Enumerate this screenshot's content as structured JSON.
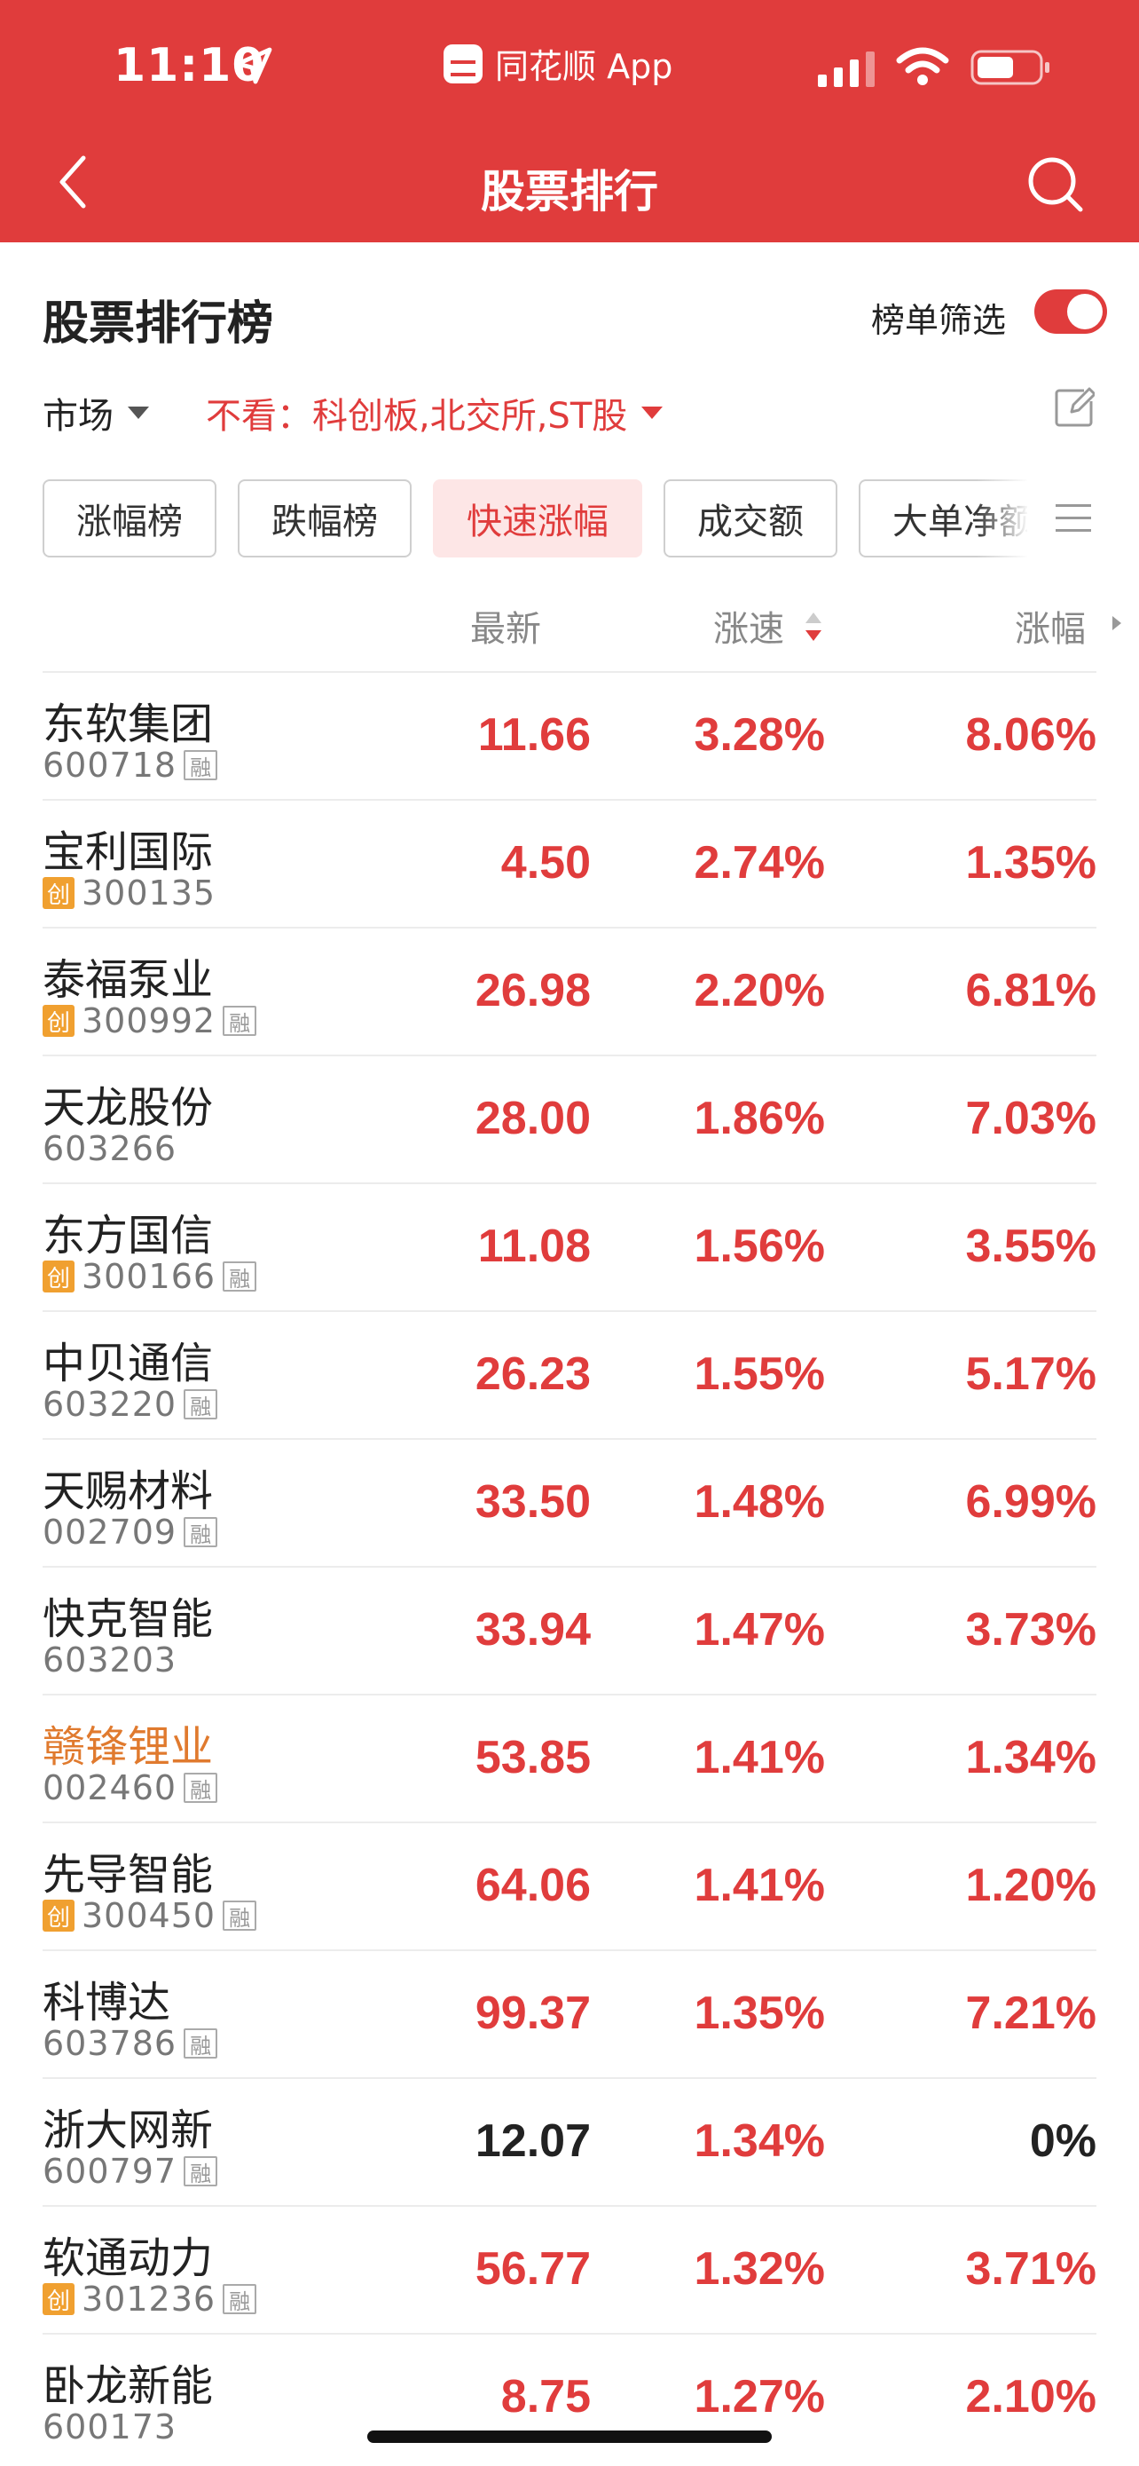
{
  "status_bar": {
    "time": "11:10",
    "app_name": "同花顺 App"
  },
  "nav": {
    "title": "股票排行"
  },
  "section": {
    "title": "股票排行榜",
    "filter_label": "榜单筛选",
    "filter_on": true,
    "market_label": "市场",
    "exclude_text": "不看：科创板,北交所,ST股"
  },
  "tabs": [
    {
      "label": "涨幅榜",
      "active": false
    },
    {
      "label": "跌幅榜",
      "active": false
    },
    {
      "label": "快速涨幅",
      "active": true
    },
    {
      "label": "成交额",
      "active": false
    },
    {
      "label": "大单净额",
      "active": false
    }
  ],
  "columns": {
    "latest": "最新",
    "speed": "涨速",
    "change": "涨幅"
  },
  "colors": {
    "accent": "#e03c3c",
    "chuang_badge": "#f0a030",
    "highlight_name": "#e07a2e"
  },
  "rows": [
    {
      "name": "东软集团",
      "code": "600718",
      "chuang": false,
      "rong": true,
      "latest": "11.66",
      "speed": "3.28%",
      "change": "8.06%"
    },
    {
      "name": "宝利国际",
      "code": "300135",
      "chuang": true,
      "rong": false,
      "latest": "4.50",
      "speed": "2.74%",
      "change": "1.35%"
    },
    {
      "name": "泰福泵业",
      "code": "300992",
      "chuang": true,
      "rong": true,
      "latest": "26.98",
      "speed": "2.20%",
      "change": "6.81%"
    },
    {
      "name": "天龙股份",
      "code": "603266",
      "chuang": false,
      "rong": false,
      "latest": "28.00",
      "speed": "1.86%",
      "change": "7.03%"
    },
    {
      "name": "东方国信",
      "code": "300166",
      "chuang": true,
      "rong": true,
      "latest": "11.08",
      "speed": "1.56%",
      "change": "3.55%"
    },
    {
      "name": "中贝通信",
      "code": "603220",
      "chuang": false,
      "rong": true,
      "latest": "26.23",
      "speed": "1.55%",
      "change": "5.17%"
    },
    {
      "name": "天赐材料",
      "code": "002709",
      "chuang": false,
      "rong": true,
      "latest": "33.50",
      "speed": "1.48%",
      "change": "6.99%"
    },
    {
      "name": "快克智能",
      "code": "603203",
      "chuang": false,
      "rong": false,
      "latest": "33.94",
      "speed": "1.47%",
      "change": "3.73%"
    },
    {
      "name": "赣锋锂业",
      "code": "002460",
      "chuang": false,
      "rong": true,
      "latest": "53.85",
      "speed": "1.41%",
      "change": "1.34%",
      "highlight": true
    },
    {
      "name": "先导智能",
      "code": "300450",
      "chuang": true,
      "rong": true,
      "latest": "64.06",
      "speed": "1.41%",
      "change": "1.20%"
    },
    {
      "name": "科博达",
      "code": "603786",
      "chuang": false,
      "rong": true,
      "latest": "99.37",
      "speed": "1.35%",
      "change": "7.21%"
    },
    {
      "name": "浙大网新",
      "code": "600797",
      "chuang": false,
      "rong": true,
      "latest": "12.07",
      "speed": "1.34%",
      "change": "0%",
      "flat": true
    },
    {
      "name": "软通动力",
      "code": "301236",
      "chuang": true,
      "rong": true,
      "latest": "56.77",
      "speed": "1.32%",
      "change": "3.71%"
    },
    {
      "name": "卧龙新能",
      "code": "600173",
      "chuang": false,
      "rong": false,
      "latest": "8.75",
      "speed": "1.27%",
      "change": "2.10%"
    }
  ],
  "badges": {
    "chuang": "创",
    "rong": "融"
  }
}
